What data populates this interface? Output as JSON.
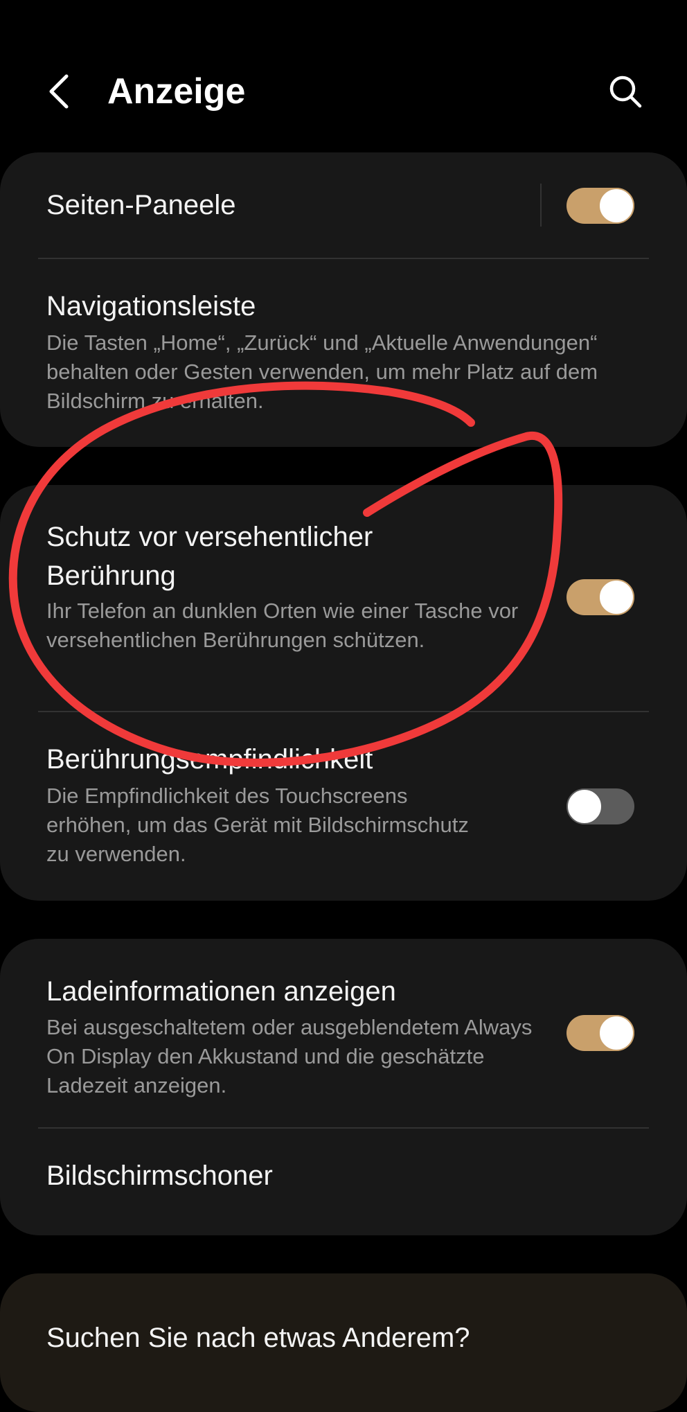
{
  "header": {
    "title": "Anzeige",
    "back_icon": "chevron-left-icon",
    "search_icon": "search-icon"
  },
  "colors": {
    "background": "#000000",
    "card": "#181818",
    "toggle_on": "#c9a06b",
    "toggle_off": "#5c5c5c",
    "annotation": "#f03a3a"
  },
  "settings": [
    {
      "title": "Seiten-Paneele",
      "description": "",
      "toggle": true
    },
    {
      "title": "Navigationsleiste",
      "description": "Die Tasten „Home“, „Zurück“ und „Aktuelle Anwendungen“ behalten oder Gesten verwenden, um mehr Platz auf dem Bildschirm zu erhalten.",
      "toggle": null
    },
    {
      "title": "Schutz vor versehentlicher Berührung",
      "description": "Ihr Telefon an dunklen Orten wie einer Tasche vor versehentlichen Berührungen schützen.",
      "toggle": true
    },
    {
      "title": "Berührungsempfindlichkeit",
      "description": "Die Empfindlichkeit des Touchscreens erhöhen, um das Gerät mit Bildschirmschutz zu verwenden.",
      "toggle": false
    },
    {
      "title": "Ladeinformationen anzeigen",
      "description": "Bei ausgeschaltetem oder ausgeblendetem Always On Display den Akkustand und die geschätzte Ladezeit anzeigen.",
      "toggle": true
    },
    {
      "title": "Bildschirmschoner",
      "description": "",
      "toggle": null
    }
  ],
  "footer": {
    "prompt": "Suchen Sie nach etwas Anderem?"
  }
}
